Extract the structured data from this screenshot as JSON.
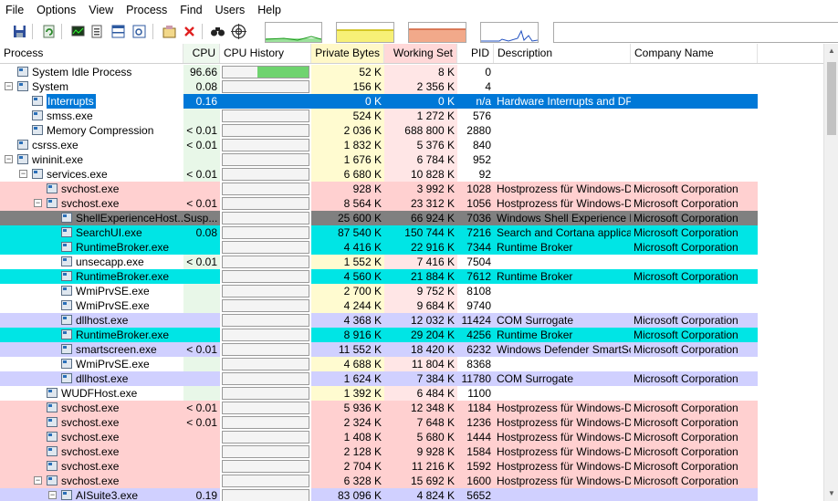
{
  "menu": [
    "File",
    "Options",
    "View",
    "Process",
    "Find",
    "Users",
    "Help"
  ],
  "toolbar": {
    "buttons": [
      "save-icon",
      "refresh-icon",
      "system-info-icon",
      "process-tree-icon",
      "lower-pane-icon",
      "find-window-icon",
      "properties-icon",
      "kill-process-icon",
      "find-handle-icon",
      "target-icon"
    ]
  },
  "columns": {
    "process": "Process",
    "cpu": "CPU",
    "cpu_history": "CPU History",
    "private_bytes": "Private Bytes",
    "working_set": "Working Set",
    "pid": "PID",
    "description": "Description",
    "company": "Company Name"
  },
  "colors": {
    "services": "#ffd0d0",
    "immersive": "#00e5e5",
    "own_process": "#d0d0ff",
    "selected": "#0078d7",
    "suspended": "#808080",
    "cpu_col": "#e8f7e8",
    "private_col": "#fffbd0",
    "working_col": "#ffe6e6"
  },
  "rows": [
    {
      "name": "System Idle Process",
      "level": 0,
      "exp": "",
      "cpu": "96.66",
      "pb": "52 K",
      "ws": "8 K",
      "pid": "0",
      "desc": "",
      "company": "",
      "style": "",
      "hist": 0.6
    },
    {
      "name": "System",
      "level": 0,
      "exp": "minus",
      "cpu": "0.08",
      "pb": "156 K",
      "ws": "2 356 K",
      "pid": "4",
      "desc": "",
      "company": "",
      "style": "",
      "hist": 0
    },
    {
      "name": "Interrupts",
      "level": 1,
      "exp": "",
      "cpu": "0.16",
      "pb": "0 K",
      "ws": "0 K",
      "pid": "n/a",
      "desc": "Hardware Interrupts and DPCs",
      "company": "",
      "style": "selected",
      "hist": 0
    },
    {
      "name": "smss.exe",
      "level": 1,
      "exp": "",
      "cpu": "",
      "pb": "524 K",
      "ws": "1 272 K",
      "pid": "576",
      "desc": "",
      "company": "",
      "style": "",
      "hist": 0
    },
    {
      "name": "Memory Compression",
      "level": 1,
      "exp": "",
      "cpu": "< 0.01",
      "pb": "2 036 K",
      "ws": "688 800 K",
      "pid": "2880",
      "desc": "",
      "company": "",
      "style": "",
      "hist": 0
    },
    {
      "name": "csrss.exe",
      "level": 0,
      "exp": "",
      "cpu": "< 0.01",
      "pb": "1 832 K",
      "ws": "5 376 K",
      "pid": "840",
      "desc": "",
      "company": "",
      "style": "",
      "hist": 0
    },
    {
      "name": "wininit.exe",
      "level": 0,
      "exp": "minus",
      "cpu": "",
      "pb": "1 676 K",
      "ws": "6 784 K",
      "pid": "952",
      "desc": "",
      "company": "",
      "style": "",
      "hist": 0
    },
    {
      "name": "services.exe",
      "level": 1,
      "exp": "minus",
      "cpu": "< 0.01",
      "pb": "6 680 K",
      "ws": "10 828 K",
      "pid": "92",
      "desc": "",
      "company": "",
      "style": "",
      "hist": 0
    },
    {
      "name": "svchost.exe",
      "level": 2,
      "exp": "",
      "cpu": "",
      "pb": "928 K",
      "ws": "3 992 K",
      "pid": "1028",
      "desc": "Hostprozess für Windows-Di...",
      "company": "Microsoft Corporation",
      "style": "services",
      "hist": 0
    },
    {
      "name": "svchost.exe",
      "level": 2,
      "exp": "minus",
      "cpu": "< 0.01",
      "pb": "8 564 K",
      "ws": "23 312 K",
      "pid": "1056",
      "desc": "Hostprozess für Windows-Di...",
      "company": "Microsoft Corporation",
      "style": "services",
      "hist": 0
    },
    {
      "name": "ShellExperienceHost....",
      "level": 3,
      "exp": "",
      "cpu": "Susp...",
      "pb": "25 600 K",
      "ws": "66 924 K",
      "pid": "7036",
      "desc": "Windows Shell Experience H...",
      "company": "Microsoft Corporation",
      "style": "suspended",
      "hist": 0
    },
    {
      "name": "SearchUI.exe",
      "level": 3,
      "exp": "",
      "cpu": "0.08",
      "pb": "87 540 K",
      "ws": "150 744 K",
      "pid": "7216",
      "desc": "Search and Cortana applicati...",
      "company": "Microsoft Corporation",
      "style": "immersive",
      "hist": 0
    },
    {
      "name": "RuntimeBroker.exe",
      "level": 3,
      "exp": "",
      "cpu": "",
      "pb": "4 416 K",
      "ws": "22 916 K",
      "pid": "7344",
      "desc": "Runtime Broker",
      "company": "Microsoft Corporation",
      "style": "immersive",
      "hist": 0
    },
    {
      "name": "unsecapp.exe",
      "level": 3,
      "exp": "",
      "cpu": "< 0.01",
      "pb": "1 552 K",
      "ws": "7 416 K",
      "pid": "7504",
      "desc": "",
      "company": "",
      "style": "",
      "hist": 0
    },
    {
      "name": "RuntimeBroker.exe",
      "level": 3,
      "exp": "",
      "cpu": "",
      "pb": "4 560 K",
      "ws": "21 884 K",
      "pid": "7612",
      "desc": "Runtime Broker",
      "company": "Microsoft Corporation",
      "style": "immersive",
      "hist": 0
    },
    {
      "name": "WmiPrvSE.exe",
      "level": 3,
      "exp": "",
      "cpu": "",
      "pb": "2 700 K",
      "ws": "9 752 K",
      "pid": "8108",
      "desc": "",
      "company": "",
      "style": "",
      "hist": 0
    },
    {
      "name": "WmiPrvSE.exe",
      "level": 3,
      "exp": "",
      "cpu": "",
      "pb": "4 244 K",
      "ws": "9 684 K",
      "pid": "9740",
      "desc": "",
      "company": "",
      "style": "",
      "hist": 0
    },
    {
      "name": "dllhost.exe",
      "level": 3,
      "exp": "",
      "cpu": "",
      "pb": "4 368 K",
      "ws": "12 032 K",
      "pid": "11424",
      "desc": "COM Surrogate",
      "company": "Microsoft Corporation",
      "style": "own",
      "hist": 0
    },
    {
      "name": "RuntimeBroker.exe",
      "level": 3,
      "exp": "",
      "cpu": "",
      "pb": "8 916 K",
      "ws": "29 204 K",
      "pid": "4256",
      "desc": "Runtime Broker",
      "company": "Microsoft Corporation",
      "style": "immersive",
      "hist": 0
    },
    {
      "name": "smartscreen.exe",
      "level": 3,
      "exp": "",
      "cpu": "< 0.01",
      "pb": "11 552 K",
      "ws": "18 420 K",
      "pid": "6232",
      "desc": "Windows Defender SmartScr...",
      "company": "Microsoft Corporation",
      "style": "own",
      "hist": 0
    },
    {
      "name": "WmiPrvSE.exe",
      "level": 3,
      "exp": "",
      "cpu": "",
      "pb": "4 688 K",
      "ws": "11 804 K",
      "pid": "8368",
      "desc": "",
      "company": "",
      "style": "",
      "hist": 0
    },
    {
      "name": "dllhost.exe",
      "level": 3,
      "exp": "",
      "cpu": "",
      "pb": "1 624 K",
      "ws": "7 384 K",
      "pid": "11780",
      "desc": "COM Surrogate",
      "company": "Microsoft Corporation",
      "style": "own",
      "hist": 0
    },
    {
      "name": "WUDFHost.exe",
      "level": 2,
      "exp": "",
      "cpu": "",
      "pb": "1 392 K",
      "ws": "6 484 K",
      "pid": "1100",
      "desc": "",
      "company": "",
      "style": "",
      "hist": 0
    },
    {
      "name": "svchost.exe",
      "level": 2,
      "exp": "",
      "cpu": "< 0.01",
      "pb": "5 936 K",
      "ws": "12 348 K",
      "pid": "1184",
      "desc": "Hostprozess für Windows-Di...",
      "company": "Microsoft Corporation",
      "style": "services",
      "hist": 0
    },
    {
      "name": "svchost.exe",
      "level": 2,
      "exp": "",
      "cpu": "< 0.01",
      "pb": "2 324 K",
      "ws": "7 648 K",
      "pid": "1236",
      "desc": "Hostprozess für Windows-Di...",
      "company": "Microsoft Corporation",
      "style": "services",
      "hist": 0
    },
    {
      "name": "svchost.exe",
      "level": 2,
      "exp": "",
      "cpu": "",
      "pb": "1 408 K",
      "ws": "5 680 K",
      "pid": "1444",
      "desc": "Hostprozess für Windows-Di...",
      "company": "Microsoft Corporation",
      "style": "services",
      "hist": 0
    },
    {
      "name": "svchost.exe",
      "level": 2,
      "exp": "",
      "cpu": "",
      "pb": "2 128 K",
      "ws": "9 928 K",
      "pid": "1584",
      "desc": "Hostprozess für Windows-Di...",
      "company": "Microsoft Corporation",
      "style": "services",
      "hist": 0
    },
    {
      "name": "svchost.exe",
      "level": 2,
      "exp": "",
      "cpu": "",
      "pb": "2 704 K",
      "ws": "11 216 K",
      "pid": "1592",
      "desc": "Hostprozess für Windows-Di...",
      "company": "Microsoft Corporation",
      "style": "services",
      "hist": 0
    },
    {
      "name": "svchost.exe",
      "level": 2,
      "exp": "minus",
      "cpu": "",
      "pb": "6 328 K",
      "ws": "15 692 K",
      "pid": "1600",
      "desc": "Hostprozess für Windows-Di...",
      "company": "Microsoft Corporation",
      "style": "services",
      "hist": 0
    },
    {
      "name": "AISuite3.exe",
      "level": 3,
      "exp": "minus",
      "cpu": "0.19",
      "pb": "83 096 K",
      "ws": "4 824 K",
      "pid": "5652",
      "desc": "",
      "company": "",
      "style": "own",
      "hist": 0
    }
  ]
}
